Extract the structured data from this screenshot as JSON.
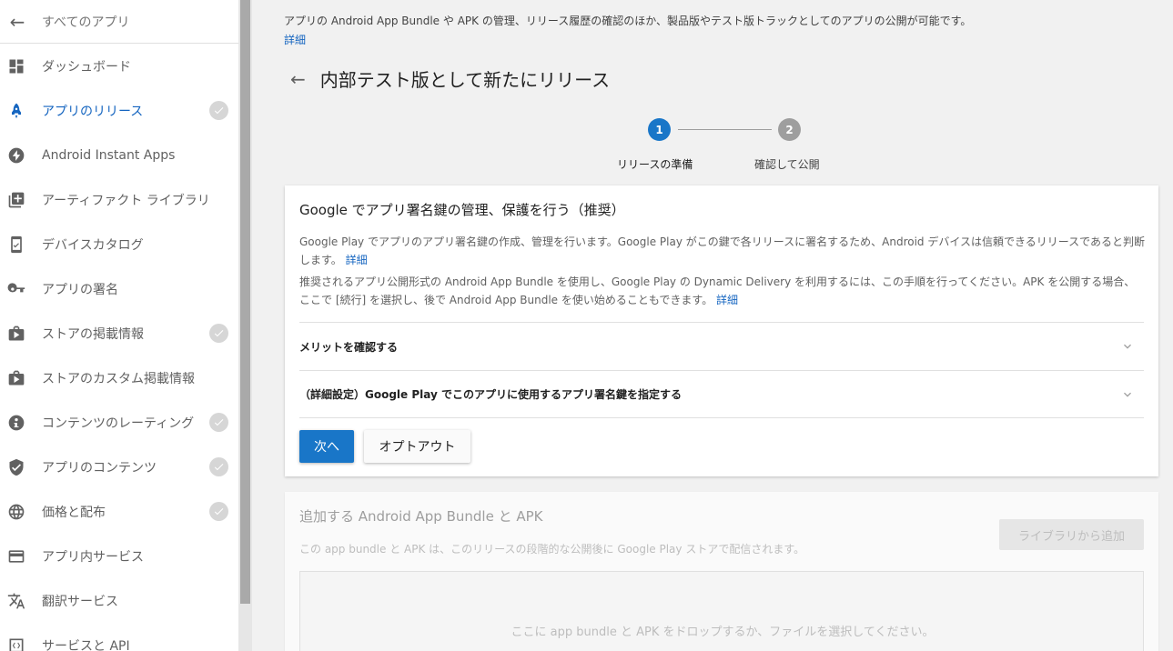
{
  "sidebar": {
    "back_label": "すべてのアプリ",
    "items": [
      {
        "label": "ダッシュボード",
        "icon": "dashboard-icon",
        "checked": false,
        "active": false
      },
      {
        "label": "アプリのリリース",
        "icon": "rocket-icon",
        "checked": true,
        "active": true
      },
      {
        "label": "Android Instant Apps",
        "icon": "lightning-icon",
        "checked": false,
        "active": false
      },
      {
        "label": "アーティファクト ライブラリ",
        "icon": "library-icon",
        "checked": false,
        "active": false
      },
      {
        "label": "デバイスカタログ",
        "icon": "device-check-icon",
        "checked": false,
        "active": false
      },
      {
        "label": "アプリの署名",
        "icon": "key-icon",
        "checked": false,
        "active": false
      },
      {
        "label": "ストアの掲載情報",
        "icon": "store-play-icon",
        "checked": true,
        "active": false
      },
      {
        "label": "ストアのカスタム掲載情報",
        "icon": "store-play-icon",
        "checked": false,
        "active": false
      },
      {
        "label": "コンテンツのレーティング",
        "icon": "rating-icon",
        "checked": true,
        "active": false
      },
      {
        "label": "アプリのコンテンツ",
        "icon": "shield-icon",
        "checked": true,
        "active": false
      },
      {
        "label": "価格と配布",
        "icon": "globe-icon",
        "checked": true,
        "active": false
      },
      {
        "label": "アプリ内サービス",
        "icon": "card-icon",
        "checked": false,
        "active": false
      },
      {
        "label": "翻訳サービス",
        "icon": "translate-icon",
        "checked": false,
        "active": false
      },
      {
        "label": "サービスと API",
        "icon": "api-icon",
        "checked": false,
        "active": false
      }
    ]
  },
  "main": {
    "intro": "アプリの Android App Bundle や APK の管理、リリース履歴の確認のほか、製品版やテスト版トラックとしてのアプリの公開が可能です。",
    "intro_link": "詳細",
    "page_title": "内部テスト版として新たにリリース",
    "stepper": {
      "step1_num": "1",
      "step1_label": "リリースの準備",
      "step2_num": "2",
      "step2_label": "確認して公開"
    },
    "signing_card": {
      "title": "Google でアプリ署名鍵の管理、保護を行う（推奨）",
      "p1": "Google Play でアプリのアプリ署名鍵の作成、管理を行います。Google Play がこの鍵で各リリースに署名するため、Android デバイスは信頼できるリリースであると判断します。",
      "p1_link": "詳細",
      "p2": "推奨されるアプリ公開形式の Android App Bundle を使用し、Google Play の Dynamic Delivery を利用するには、この手順を行ってください。APK を公開する場合、ここで [続行] を選択し、後で Android App Bundle を使い始めることもできます。",
      "p2_link": "詳細",
      "accordion1": "メリットを確認する",
      "accordion2": "（詳細設定）Google Play でこのアプリに使用するアプリ署名鍵を指定する",
      "next_button": "次へ",
      "optout_button": "オプトアウト"
    },
    "bundle_card": {
      "title": "追加する Android App Bundle と APK",
      "subtitle": "この app bundle と APK は、このリリースの段階的な公開後に Google Play ストアで配信されます。",
      "library_button": "ライブラリから追加",
      "dropzone_text": "ここに app bundle と APK をドロップするか、ファイルを選択してください。"
    }
  }
}
